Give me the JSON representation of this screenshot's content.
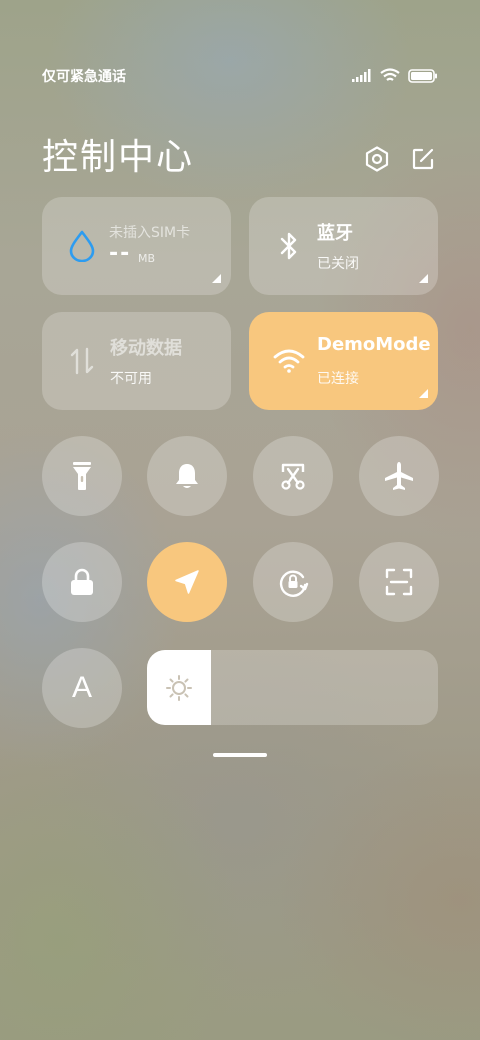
{
  "status_bar": {
    "carrier": "仅可紧急通话",
    "icons": [
      "signal-icon",
      "wifi-icon",
      "battery-icon"
    ]
  },
  "header": {
    "title": "控制中心",
    "settings_icon": "settings-icon",
    "edit_icon": "edit-icon"
  },
  "tiles": {
    "data_usage": {
      "title": "未插入SIM卡",
      "value": "--",
      "unit": "MB",
      "icon": "water-drop-icon",
      "accent": "#2d9cf0"
    },
    "bluetooth": {
      "title": "蓝牙",
      "subtitle": "已关闭",
      "icon": "bluetooth-icon"
    },
    "mobile_data": {
      "title": "移动数据",
      "subtitle": "不可用",
      "icon": "mobile-data-icon"
    },
    "wifi": {
      "title": "DemoMode",
      "subtitle": "已连接",
      "icon": "wifi-icon",
      "color": "#f8c77e"
    }
  },
  "toggles_row1": [
    "flashlight-icon",
    "bell-icon",
    "screenshot-icon",
    "airplane-icon"
  ],
  "toggles_row2": [
    "lock-icon",
    "location-icon",
    "rotation-lock-icon",
    "scan-icon"
  ],
  "auto_brightness_label": "A",
  "brightness": {
    "level": 0.22,
    "icon": "sun-icon"
  },
  "colors": {
    "accent": "#f8c77e"
  }
}
